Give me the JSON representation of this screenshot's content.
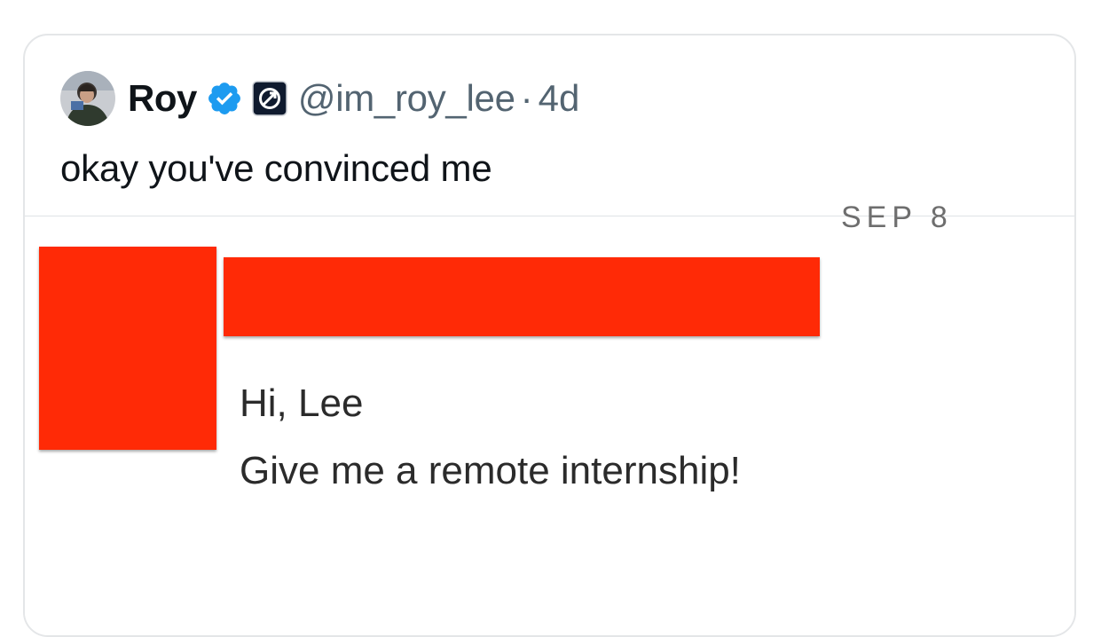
{
  "tweet": {
    "author_name": "Roy",
    "handle": "@im_roy_lee",
    "separator": "·",
    "time": "4d",
    "text": "okay you've convinced me",
    "verified_color": "#1d9bf0"
  },
  "media": {
    "date_fragment": "SEP 8",
    "message_greeting": "Hi, Lee",
    "message_body": "Give me a remote internship!",
    "redaction_color": "#ff2a06"
  }
}
